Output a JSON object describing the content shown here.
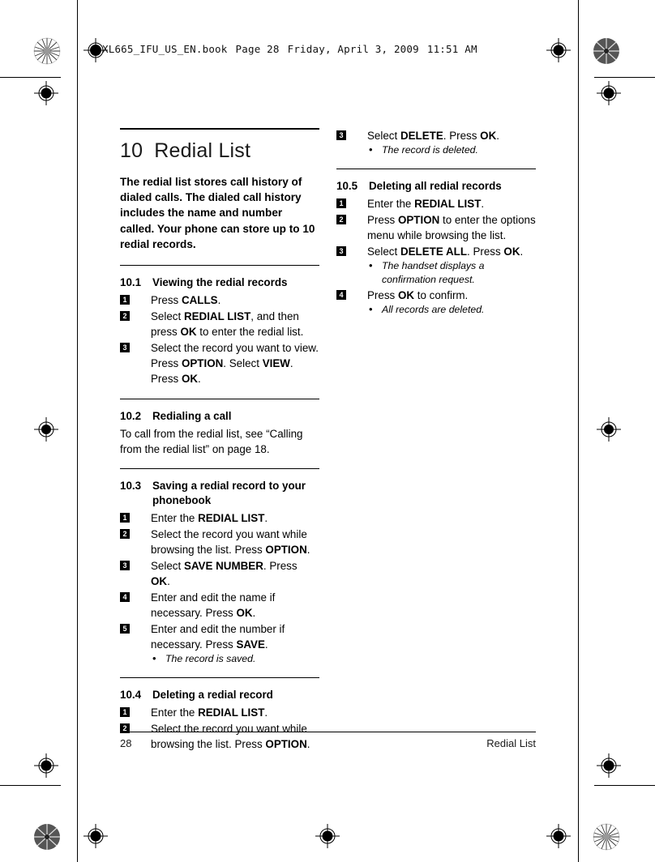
{
  "file_header": {
    "filename": "XL665_IFU_US_EN.book",
    "page": "Page 28",
    "day": "Friday, April 3, 2009",
    "time": "11:51 AM"
  },
  "chapter": {
    "number": "10",
    "title": "Redial List",
    "intro": "The redial list stores call history of dialed calls. The dialed call history includes the name and number called. Your phone can store up to 10 redial records."
  },
  "sections": {
    "s101": {
      "num": "10.1",
      "title": "Viewing the redial records",
      "steps": [
        {
          "n": "1",
          "html": "Press <b class=\"kbd\">CALLS</b>."
        },
        {
          "n": "2",
          "html": "Select <b class=\"kbd\">REDIAL LIST</b>, and then press <b class=\"kbd\">OK</b> to enter the redial list."
        },
        {
          "n": "3",
          "html": "Select the record you want to view. Press <b class=\"kbd\">OPTION</b>. Select <b class=\"kbd\">VIEW</b>. Press <b class=\"kbd\">OK</b>."
        }
      ]
    },
    "s102": {
      "num": "10.2",
      "title": "Redialing a call",
      "body": "To call from the redial list, see “Calling from the redial list” on page 18."
    },
    "s103": {
      "num": "10.3",
      "title": "Saving a redial record to your phonebook",
      "steps": [
        {
          "n": "1",
          "html": "Enter the <b class=\"kbd\">REDIAL LIST</b>."
        },
        {
          "n": "2",
          "html": "Select the record you want while browsing the list. Press <b class=\"kbd\">OPTION</b>."
        },
        {
          "n": "3",
          "html": "Select <b class=\"kbd\">SAVE NUMBER</b>. Press <b class=\"kbd\">OK</b>."
        },
        {
          "n": "4",
          "html": "Enter and edit the name if necessary. Press <b class=\"kbd\">OK</b>."
        },
        {
          "n": "5",
          "html": "Enter and edit the number if necessary. Press <b class=\"kbd\">SAVE</b>.",
          "notes": [
            "The record is saved."
          ]
        }
      ]
    },
    "s104": {
      "num": "10.4",
      "title": "Deleting a redial record",
      "steps": [
        {
          "n": "1",
          "html": "Enter the <b class=\"kbd\">REDIAL LIST</b>."
        },
        {
          "n": "2",
          "html": "Select the record you want while browsing the list. Press <b class=\"kbd\">OPTION</b>."
        },
        {
          "n": "3",
          "html": "Select <b class=\"kbd\">DELETE</b>. Press <b class=\"kbd\">OK</b>.",
          "notes": [
            "The record is deleted."
          ]
        }
      ]
    },
    "s105": {
      "num": "10.5",
      "title": "Deleting all redial records",
      "steps": [
        {
          "n": "1",
          "html": "Enter the <b class=\"kbd\">REDIAL LIST</b>."
        },
        {
          "n": "2",
          "html": "Press <b class=\"kbd\">OPTION</b> to enter the options menu while browsing the list."
        },
        {
          "n": "3",
          "html": "Select <b class=\"kbd\">DELETE ALL</b>. Press <b class=\"kbd\">OK</b>.",
          "notes": [
            "The handset displays a confirmation request."
          ]
        },
        {
          "n": "4",
          "html": "Press <b class=\"kbd\">OK</b> to confirm.",
          "notes": [
            "All records are deleted."
          ]
        }
      ]
    }
  },
  "footer": {
    "page_number": "28",
    "chapter_name": "Redial List"
  }
}
